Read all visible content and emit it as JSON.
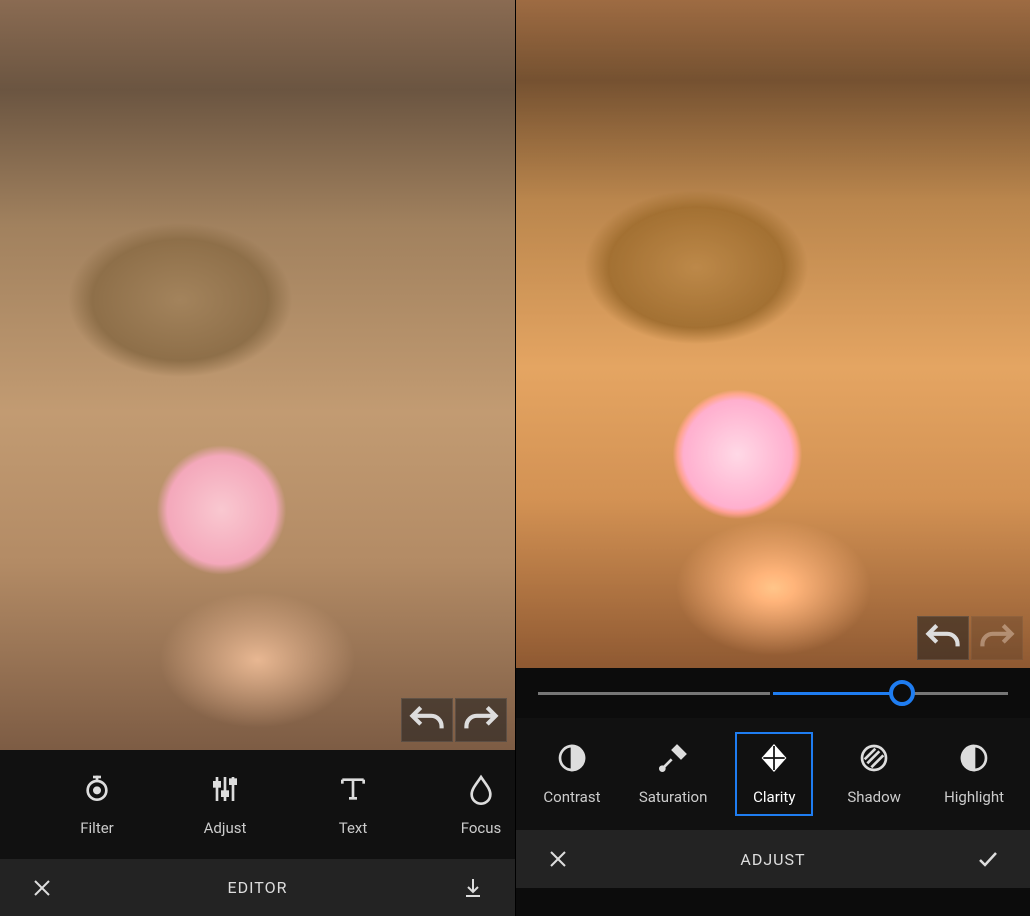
{
  "left": {
    "title": "EDITOR",
    "tools": [
      {
        "id": "filter",
        "label": "Filter"
      },
      {
        "id": "adjust",
        "label": "Adjust"
      },
      {
        "id": "text",
        "label": "Text"
      },
      {
        "id": "focus",
        "label": "Focus"
      }
    ]
  },
  "right": {
    "title": "ADJUST",
    "slider": {
      "min": -100,
      "max": 100,
      "value": 55
    },
    "tools": [
      {
        "id": "contrast",
        "label": "Contrast",
        "selected": false
      },
      {
        "id": "saturation",
        "label": "Saturation",
        "selected": false
      },
      {
        "id": "clarity",
        "label": "Clarity",
        "selected": true
      },
      {
        "id": "shadow",
        "label": "Shadow",
        "selected": false
      },
      {
        "id": "highlight",
        "label": "Highlight",
        "selected": false
      }
    ]
  }
}
